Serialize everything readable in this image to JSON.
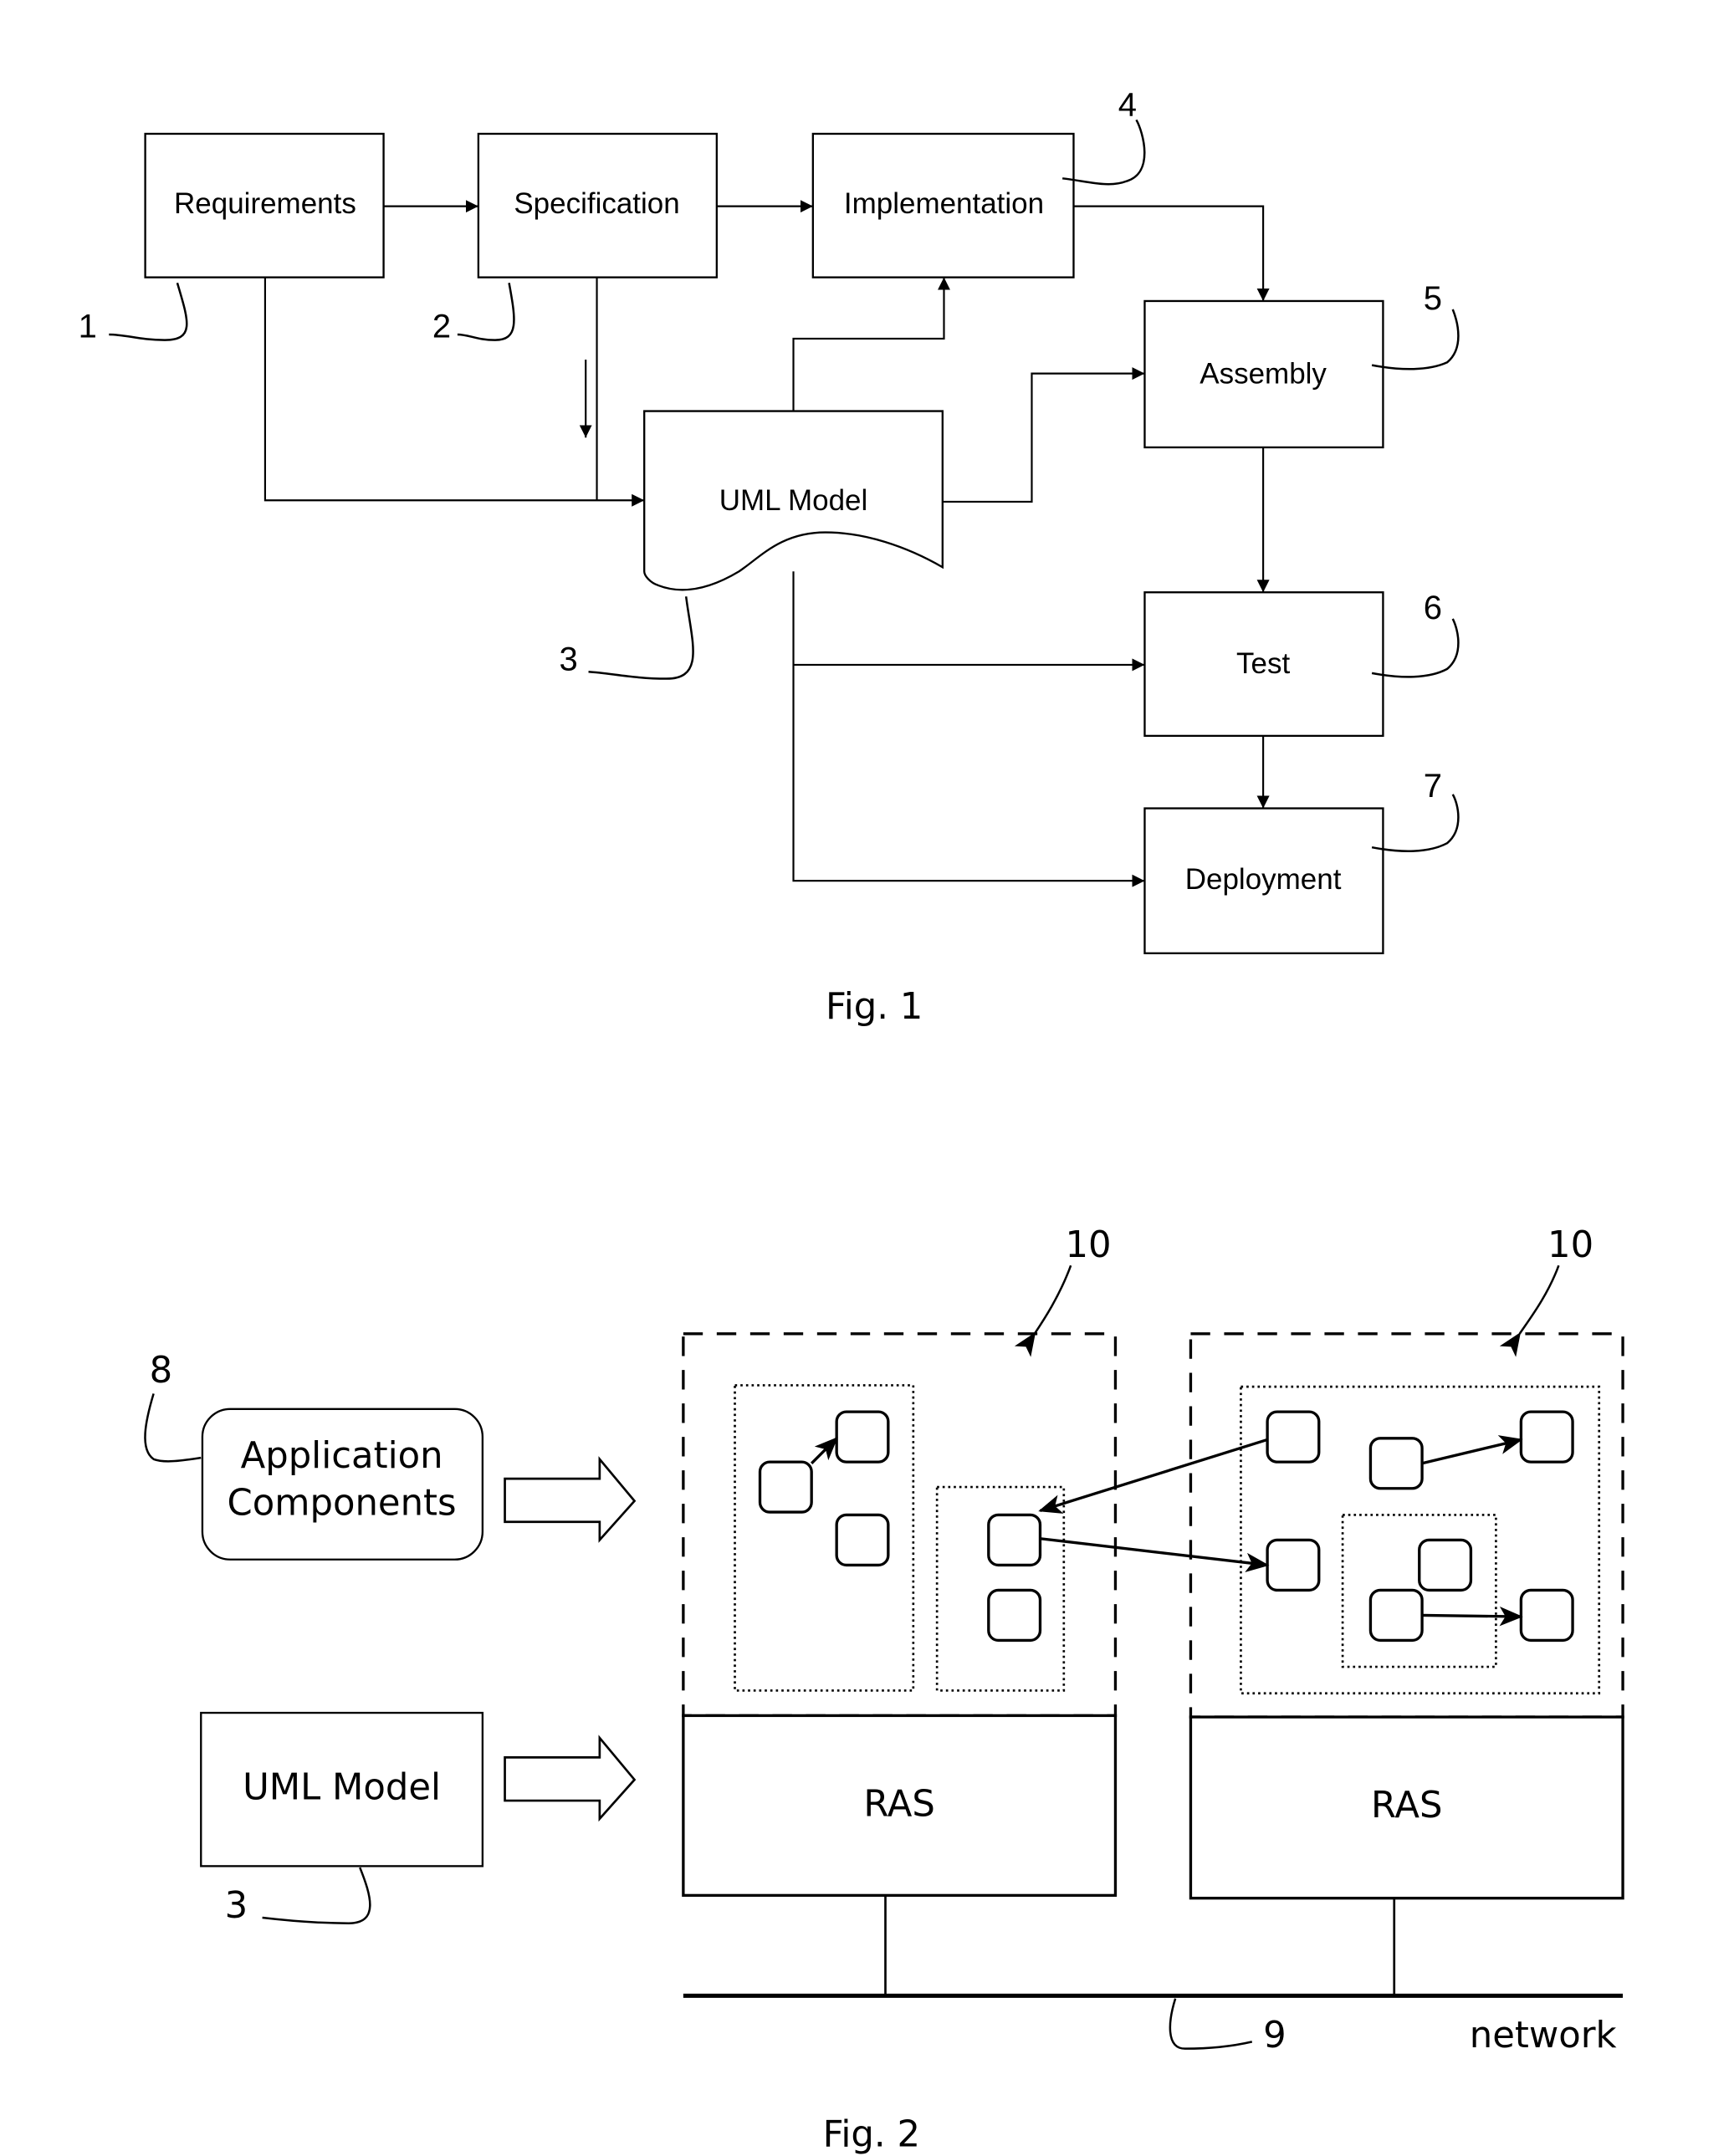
{
  "fig1": {
    "caption": "Fig. 1",
    "boxes": {
      "requirements": "Requirements",
      "specification": "Specification",
      "implementation": "Implementation",
      "assembly": "Assembly",
      "test": "Test",
      "deployment": "Deployment",
      "uml_model": "UML Model"
    },
    "refs": {
      "requirements": "1",
      "specification": "2",
      "uml_model": "3",
      "implementation": "4",
      "assembly": "5",
      "test": "6",
      "deployment": "7"
    }
  },
  "fig2": {
    "caption": "Fig. 2",
    "application_components": [
      "Application",
      "Components"
    ],
    "uml_model": "UML Model",
    "ras_left": "RAS",
    "ras_right": "RAS",
    "network_label": "network",
    "refs": {
      "application_components": "8",
      "uml_model": "3",
      "network": "9",
      "container_left": "10",
      "container_right": "10"
    }
  }
}
